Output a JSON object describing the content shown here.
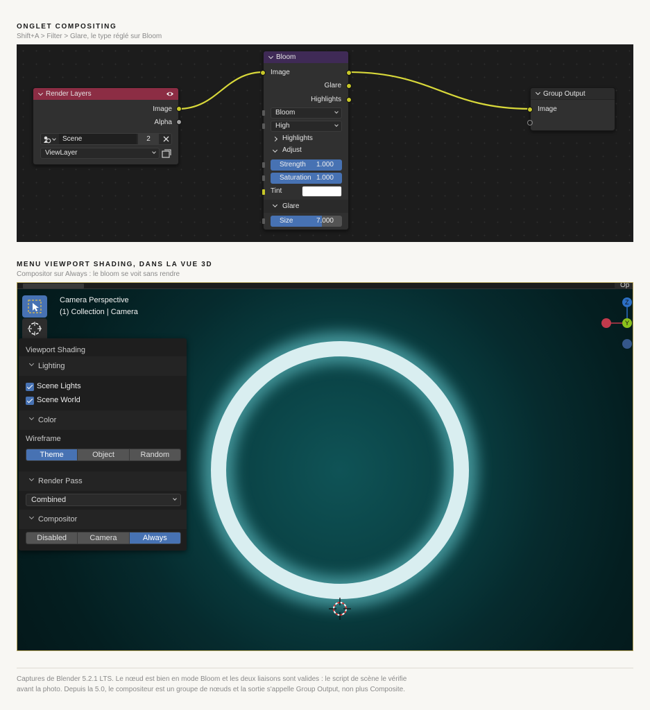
{
  "section1": {
    "title": "ONGLET COMPOSITING",
    "subtitle": "Shift+A > Filter > Glare, le type réglé sur Bloom"
  },
  "render_layers": {
    "title": "Render Layers",
    "header_color": "#8c2d44",
    "outputs": [
      "Image",
      "Alpha"
    ],
    "scene": {
      "name": "Scene",
      "users": "2"
    },
    "view_layer": "ViewLayer",
    "icons": [
      "eye-icon",
      "scene-icon",
      "close-icon",
      "view-layer-icon"
    ]
  },
  "bloom": {
    "title": "Bloom",
    "header_color": "#3f2a56",
    "input": "Image",
    "outputs": [
      "Glare",
      "Highlights"
    ],
    "type": "Bloom",
    "quality": "High",
    "panels": {
      "highlights": "Highlights",
      "adjust": "Adjust",
      "glare": "Glare"
    },
    "strength": {
      "label": "Strength",
      "value": "1.000"
    },
    "saturation": {
      "label": "Saturation",
      "value": "1.000"
    },
    "tint": {
      "label": "Tint",
      "color": "#ffffff"
    },
    "size": {
      "label": "Size",
      "value": "7.000",
      "fraction": 0.72
    }
  },
  "group_output": {
    "title": "Group Output",
    "input": "Image"
  },
  "section2": {
    "title": "MENU VIEWPORT SHADING, DANS LA VUE 3D",
    "subtitle": "Compositor sur Always : le bloom se voit sans rendre"
  },
  "viewport": {
    "camera_line1": "Camera Perspective",
    "camera_line2": "(1) Collection | Camera",
    "gizmo": {
      "z": "Z",
      "y": "Y"
    },
    "corner_label": "Op",
    "ring_color": "#d9eef0"
  },
  "shading_panel": {
    "title": "Viewport Shading",
    "lighting": "Lighting",
    "scene_lights": {
      "label": "Scene Lights",
      "checked": true
    },
    "scene_world": {
      "label": "Scene World",
      "checked": true
    },
    "color": "Color",
    "wireframe": "Wireframe",
    "wireframe_options": [
      "Theme",
      "Object",
      "Random"
    ],
    "wireframe_selected": "Theme",
    "render_pass": "Render Pass",
    "render_pass_value": "Combined",
    "compositor": "Compositor",
    "compositor_options": [
      "Disabled",
      "Camera",
      "Always"
    ],
    "compositor_selected": "Always"
  },
  "footer": {
    "line1": "Captures de Blender 5.2.1 LTS. Le nœud est bien en mode Bloom et les deux liaisons sont valides : le script de scène le vérifie",
    "line2": "avant la photo. Depuis la 5.0, le compositeur est un groupe de nœuds et la sortie s'appelle Group Output, non plus Composite."
  },
  "colors": {
    "accent": "#4772b3",
    "socket_yellow": "#c7c729",
    "link": "#d8d83a"
  }
}
